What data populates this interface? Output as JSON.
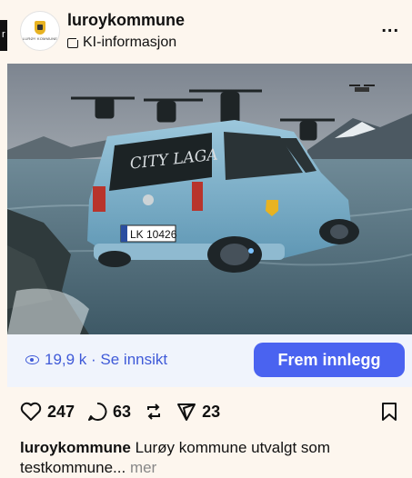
{
  "header": {
    "avatar_text": "LURØY KOMMUNE",
    "username": "luroykommune",
    "ai_label": "KI-informasjon",
    "more": "..."
  },
  "left_tab": {
    "text": "r"
  },
  "photo": {
    "plate": "LK 10426",
    "door_text": "CITY LAGA"
  },
  "insight": {
    "views": "19,9 k · Se innsikt",
    "promote_label": "Frem innlegg"
  },
  "actions": {
    "likes": "247",
    "comments": "63",
    "shares": "23"
  },
  "caption": {
    "username": "luroykommune",
    "text": " Lurøy kommune utvalgt som",
    "text2": "testkommune... ",
    "more": "mer"
  },
  "colors": {
    "accent": "#4a63f0",
    "link": "#3f5ad8",
    "car": "#7fb6d1"
  }
}
